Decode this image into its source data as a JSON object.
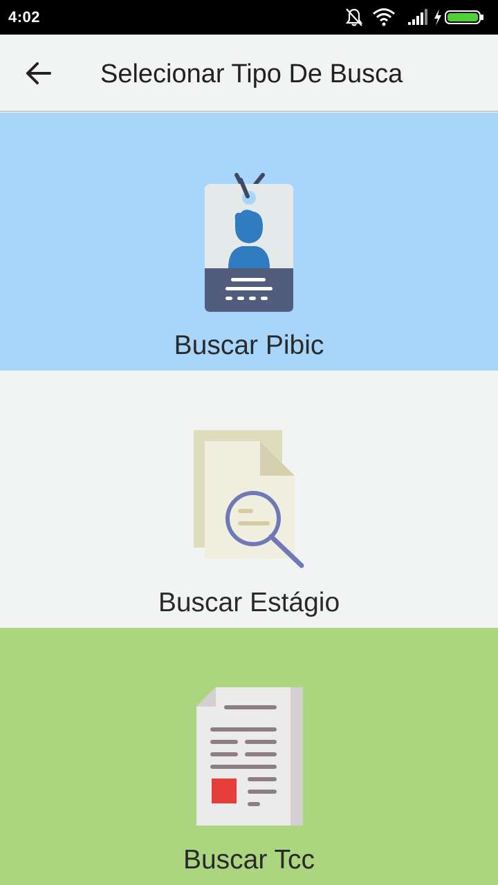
{
  "status_bar": {
    "time": "4:02",
    "icons": [
      "bell-muted-icon",
      "wifi-icon",
      "signal-icon",
      "charging-bolt-icon",
      "battery-icon"
    ],
    "battery_color": "#4cd137"
  },
  "app_bar": {
    "back_icon": "arrow-left-icon",
    "title": "Selecionar Tipo De Busca"
  },
  "options": [
    {
      "label": "Buscar Pibic",
      "icon": "id-badge-icon",
      "background": "#a8d6fa"
    },
    {
      "label": "Buscar Estágio",
      "icon": "document-search-icon",
      "background": "#f2f4f4"
    },
    {
      "label": "Buscar Tcc",
      "icon": "document-report-icon",
      "background": "#acd580"
    }
  ]
}
